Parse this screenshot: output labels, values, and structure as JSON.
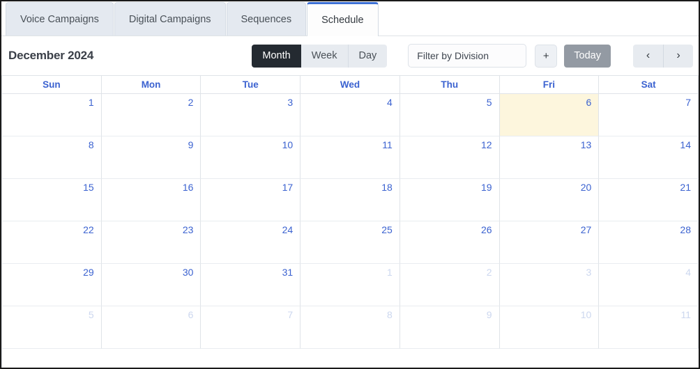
{
  "tabs": [
    {
      "label": "Voice Campaigns",
      "active": false
    },
    {
      "label": "Digital Campaigns",
      "active": false
    },
    {
      "label": "Sequences",
      "active": false
    },
    {
      "label": "Schedule",
      "active": true
    }
  ],
  "toolbar": {
    "title": "December 2024",
    "view_month_label": "Month",
    "view_week_label": "Week",
    "view_day_label": "Day",
    "active_view": "Month",
    "filter_placeholder": "Filter by Division",
    "filter_value": "",
    "add_label": "+",
    "today_label": "Today",
    "prev_label": "‹",
    "next_label": "›"
  },
  "calendar": {
    "weekday_headers": [
      "Sun",
      "Mon",
      "Tue",
      "Wed",
      "Thu",
      "Fri",
      "Sat"
    ],
    "weeks": [
      [
        {
          "day": "1",
          "other_month": false,
          "today": false
        },
        {
          "day": "2",
          "other_month": false,
          "today": false
        },
        {
          "day": "3",
          "other_month": false,
          "today": false
        },
        {
          "day": "4",
          "other_month": false,
          "today": false
        },
        {
          "day": "5",
          "other_month": false,
          "today": false
        },
        {
          "day": "6",
          "other_month": false,
          "today": true
        },
        {
          "day": "7",
          "other_month": false,
          "today": false
        }
      ],
      [
        {
          "day": "8",
          "other_month": false,
          "today": false
        },
        {
          "day": "9",
          "other_month": false,
          "today": false
        },
        {
          "day": "10",
          "other_month": false,
          "today": false
        },
        {
          "day": "11",
          "other_month": false,
          "today": false
        },
        {
          "day": "12",
          "other_month": false,
          "today": false
        },
        {
          "day": "13",
          "other_month": false,
          "today": false
        },
        {
          "day": "14",
          "other_month": false,
          "today": false
        }
      ],
      [
        {
          "day": "15",
          "other_month": false,
          "today": false
        },
        {
          "day": "16",
          "other_month": false,
          "today": false
        },
        {
          "day": "17",
          "other_month": false,
          "today": false
        },
        {
          "day": "18",
          "other_month": false,
          "today": false
        },
        {
          "day": "19",
          "other_month": false,
          "today": false
        },
        {
          "day": "20",
          "other_month": false,
          "today": false
        },
        {
          "day": "21",
          "other_month": false,
          "today": false
        }
      ],
      [
        {
          "day": "22",
          "other_month": false,
          "today": false
        },
        {
          "day": "23",
          "other_month": false,
          "today": false
        },
        {
          "day": "24",
          "other_month": false,
          "today": false
        },
        {
          "day": "25",
          "other_month": false,
          "today": false
        },
        {
          "day": "26",
          "other_month": false,
          "today": false
        },
        {
          "day": "27",
          "other_month": false,
          "today": false
        },
        {
          "day": "28",
          "other_month": false,
          "today": false
        }
      ],
      [
        {
          "day": "29",
          "other_month": false,
          "today": false
        },
        {
          "day": "30",
          "other_month": false,
          "today": false
        },
        {
          "day": "31",
          "other_month": false,
          "today": false
        },
        {
          "day": "1",
          "other_month": true,
          "today": false
        },
        {
          "day": "2",
          "other_month": true,
          "today": false
        },
        {
          "day": "3",
          "other_month": true,
          "today": false
        },
        {
          "day": "4",
          "other_month": true,
          "today": false
        }
      ],
      [
        {
          "day": "5",
          "other_month": true,
          "today": false
        },
        {
          "day": "6",
          "other_month": true,
          "today": false
        },
        {
          "day": "7",
          "other_month": true,
          "today": false
        },
        {
          "day": "8",
          "other_month": true,
          "today": false
        },
        {
          "day": "9",
          "other_month": true,
          "today": false
        },
        {
          "day": "10",
          "other_month": true,
          "today": false
        },
        {
          "day": "11",
          "other_month": true,
          "today": false
        }
      ]
    ]
  },
  "colors": {
    "accent_blue": "#3b62d0",
    "active_tab_border": "#3b6fd4",
    "today_background": "#fdf6dd",
    "active_view_background": "#242a31",
    "today_button_background": "#939aa3",
    "other_month_text": "#ccd7ef"
  }
}
